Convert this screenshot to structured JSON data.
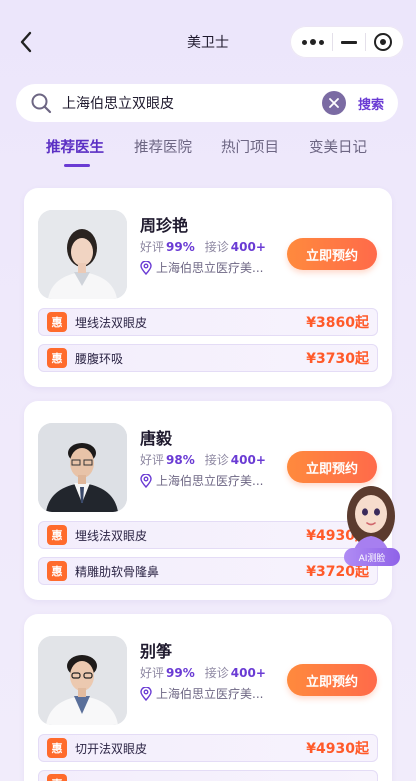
{
  "header": {
    "title": "美卫士"
  },
  "search": {
    "value": "上海伯思立双眼皮",
    "button": "搜索"
  },
  "tabs": [
    {
      "label": "推荐医生",
      "active": true
    },
    {
      "label": "推荐医院",
      "active": false
    },
    {
      "label": "热门项目",
      "active": false
    },
    {
      "label": "变美日记",
      "active": false
    }
  ],
  "stat_labels": {
    "rating": "好评",
    "consult": "接诊"
  },
  "badge_text": "惠",
  "book_label": "立即预约",
  "doctors": [
    {
      "name": "周珍艳",
      "rating": "99%",
      "consult": "400+",
      "hospital": "上海伯思立医疗美...",
      "projects": [
        {
          "name": "埋线法双眼皮",
          "price": "¥3860起"
        },
        {
          "name": "腰腹环吸",
          "price": "¥3730起"
        }
      ]
    },
    {
      "name": "唐毅",
      "rating": "98%",
      "consult": "400+",
      "hospital": "上海伯思立医疗美...",
      "projects": [
        {
          "name": "埋线法双眼皮",
          "price": "¥4930起"
        },
        {
          "name": "精雕肋软骨隆鼻",
          "price": "¥3720起"
        }
      ]
    },
    {
      "name": "别筝",
      "rating": "99%",
      "consult": "400+",
      "hospital": "上海伯思立医疗美...",
      "projects": [
        {
          "name": "切开法双眼皮",
          "price": "¥4930起"
        },
        {
          "name": "",
          "price": ""
        }
      ]
    }
  ],
  "ai_assistant": {
    "label": "AI测脸"
  },
  "colors": {
    "accent": "#6a3bd4",
    "button_orange": "#ff6a4a",
    "price": "#ff5a2a",
    "background": "#ece6fb"
  }
}
